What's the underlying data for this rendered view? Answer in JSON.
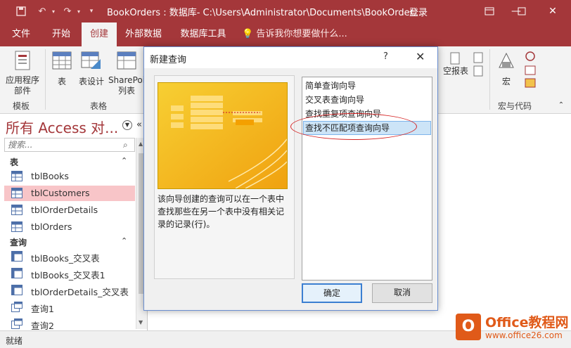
{
  "window": {
    "title": "BookOrders : 数据库- C:\\Users\\Administrator\\Documents\\BookOrder...",
    "login": "登录"
  },
  "ribbon_tabs": [
    {
      "label": "文件"
    },
    {
      "label": "开始"
    },
    {
      "label": "创建"
    },
    {
      "label": "外部数据"
    },
    {
      "label": "数据库工具"
    }
  ],
  "tell_me": "告诉我你想要做什么...",
  "ribbon": {
    "app_parts": "应用程序\n部件",
    "table": "表",
    "table_design": "表设计",
    "sharepoint": "SharePoi\n列表",
    "blank_report": "空报表",
    "macro": "宏",
    "group_templates": "模板",
    "group_tables": "表格",
    "group_macros": "宏与代码"
  },
  "nav": {
    "title": "所有 Access 对...",
    "search_placeholder": "搜索...",
    "sections": [
      {
        "label": "表",
        "items": [
          "tblBooks",
          "tblCustomers",
          "tblOrderDetails",
          "tblOrders"
        ]
      },
      {
        "label": "查询",
        "items": [
          "tblBooks_交叉表",
          "tblBooks_交叉表1",
          "tblOrderDetails_交叉表",
          "查询1",
          "查询2"
        ]
      }
    ]
  },
  "status": "就绪",
  "dialog": {
    "title": "新建查询",
    "help": "?",
    "description": "该向导创建的查询可以在一个表中查找那些在另一个表中没有相关记录的记录(行)。",
    "wizards": [
      "简单查询向导",
      "交叉表查询向导",
      "查找重复项查询向导",
      "查找不匹配项查询向导"
    ],
    "selected_index": 3,
    "ok": "确定",
    "cancel": "取消"
  },
  "watermark": {
    "name": "Office教程网",
    "url": "www.office26.com"
  },
  "colors": {
    "accent": "#a4373a",
    "selection": "#f8c5c8",
    "dialog_select": "#cce4f7",
    "watermark": "#e05a19"
  }
}
